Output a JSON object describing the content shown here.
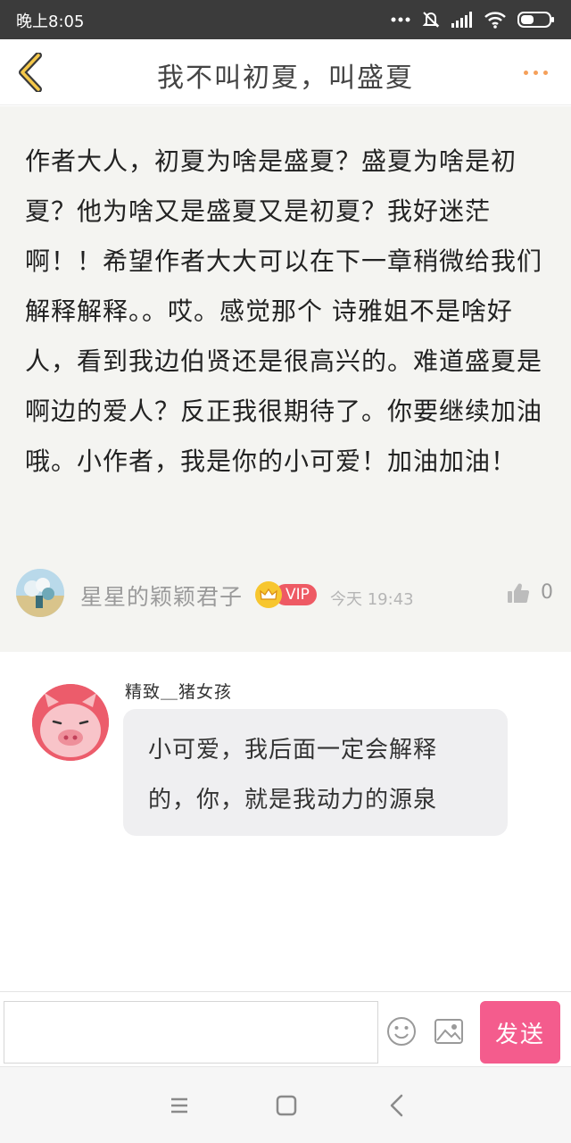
{
  "status_bar": {
    "time": "晚上8:05",
    "icons": [
      "more-dots-icon",
      "mute-icon",
      "signal-icon",
      "wifi-icon",
      "battery-icon"
    ]
  },
  "header": {
    "title": "我不叫初夏，叫盛夏",
    "back_icon": "chevron-left-icon",
    "more_icon": "more-dots-icon",
    "accent_color": "#f5a05a"
  },
  "main_comment": {
    "text": "作者大人，初夏为啥是盛夏？盛夏为啥是初夏？他为啥又是盛夏又是初夏？我好迷茫啊！！希望作者大大可以在下一章稍微给我们解释解释。。哎。感觉那个 诗雅姐不是啥好人，看到我边伯贤还是很高兴的。难道盛夏是啊边的爱人？反正我很期待了。你要继续加油哦。小作者，我是你的小可爱！加油加油！",
    "author": "星星的颖颖君子",
    "vip_label": "VIP",
    "time": "今天 19:43",
    "like_count": "0"
  },
  "reply": {
    "author": "精致＿猪女孩",
    "text": "小可爱，我后面一定会解释的，你，就是我动力的源泉"
  },
  "input_bar": {
    "placeholder": "",
    "send_label": "发送",
    "send_color": "#f45c8d"
  },
  "nav_bar": {
    "icons": [
      "menu-icon",
      "home-icon",
      "back-icon"
    ]
  }
}
